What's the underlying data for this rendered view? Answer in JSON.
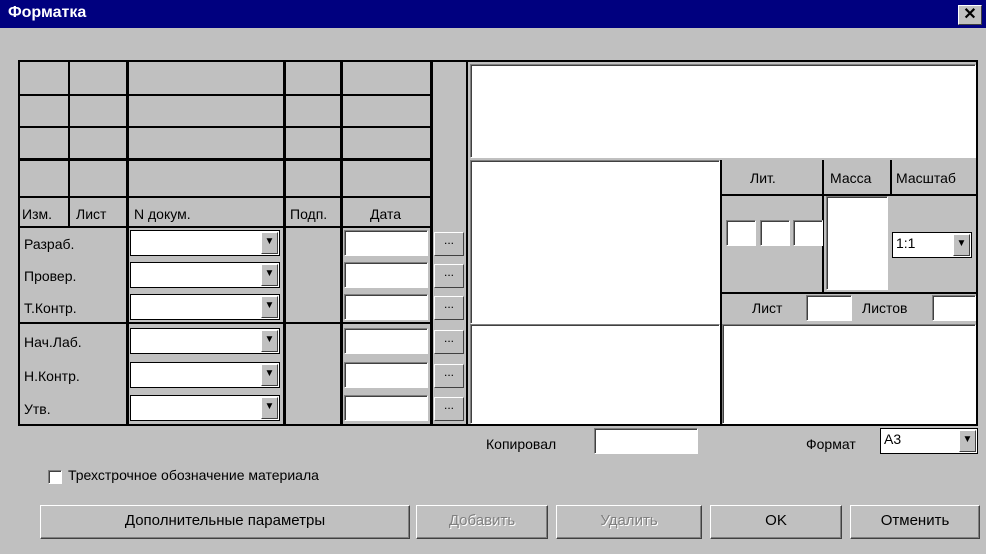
{
  "window": {
    "title": "Форматка",
    "close_glyph": "✕"
  },
  "stamp": {
    "col_izm": "Изм.",
    "col_list": "Лист",
    "col_ndoc": "N докум.",
    "col_podp": "Подп.",
    "col_date": "Дата",
    "rows": [
      {
        "label": "Разраб."
      },
      {
        "label": "Провер."
      },
      {
        "label": "Т.Контр."
      },
      {
        "label": "Нач.Лаб."
      },
      {
        "label": "Н.Контр."
      },
      {
        "label": "Утв."
      }
    ],
    "dots_label": "...",
    "lit_label": "Лит.",
    "mass_label": "Масса",
    "scale_label": "Масштаб",
    "scale_value": "1:1",
    "sheet_label": "Лист",
    "sheets_label": "Листов"
  },
  "copied_label": "Копировал",
  "format_label": "Формат",
  "format_value": "А3",
  "material_checkbox_label": "Трехстрочное обозначение материала",
  "buttons": {
    "more": "Дополнительные параметры",
    "add": "Добавить",
    "delete": "Удалить",
    "ok": "OK",
    "cancel": "Отменить"
  }
}
